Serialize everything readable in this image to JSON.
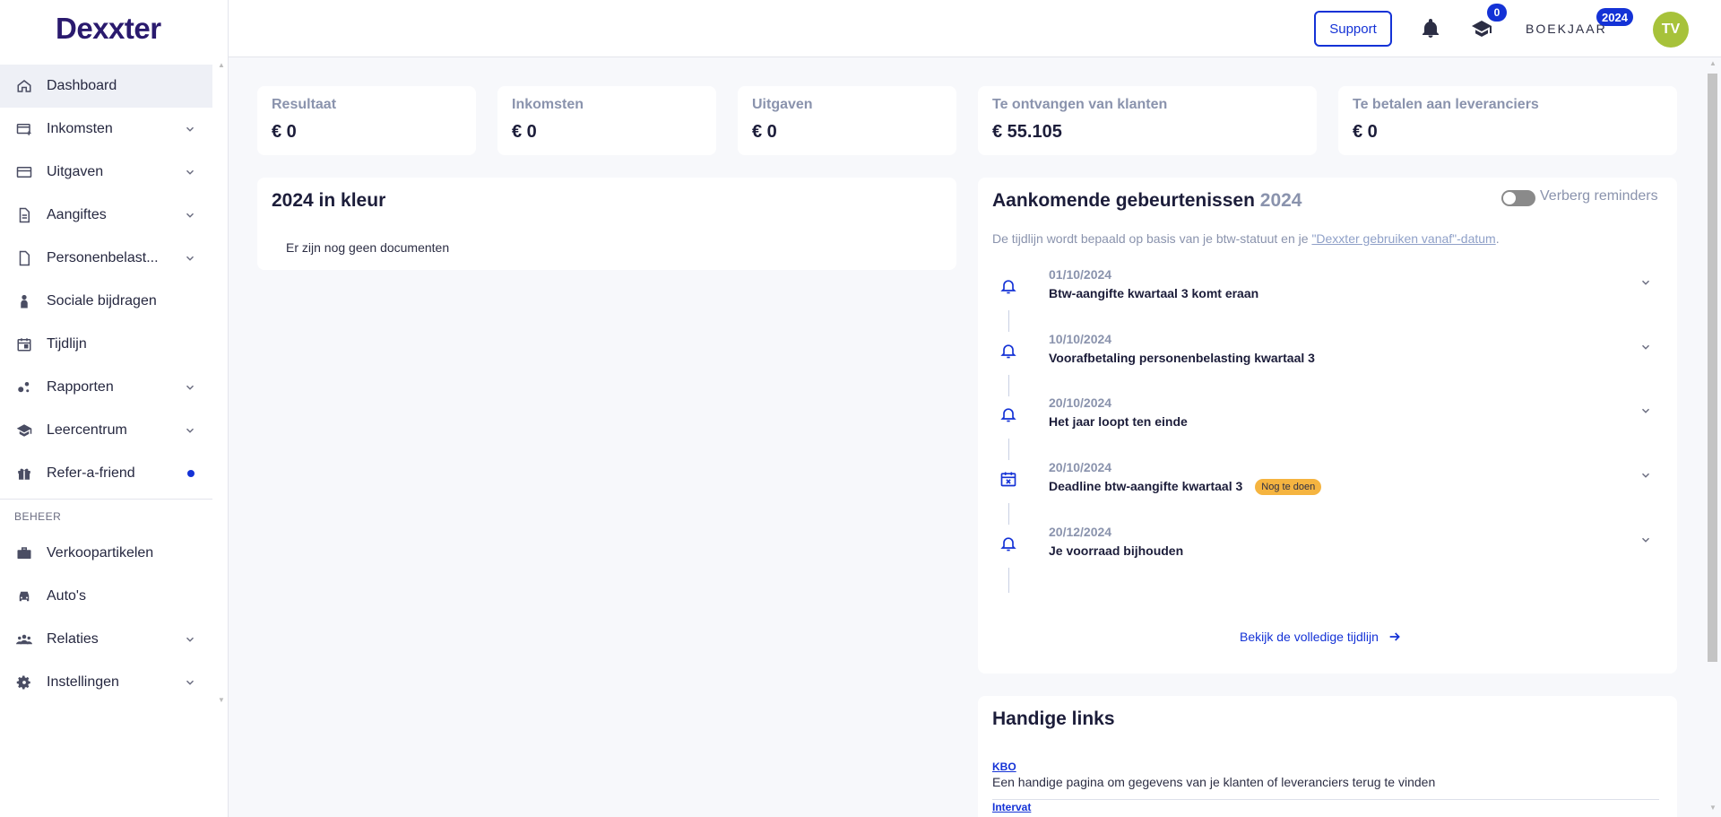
{
  "app": {
    "logo": "Dexxter"
  },
  "sidebar": {
    "items": [
      {
        "label": "Dashboard",
        "icon": "home-icon",
        "active": true
      },
      {
        "label": "Inkomsten",
        "icon": "invoice-icon",
        "expandable": true
      },
      {
        "label": "Uitgaven",
        "icon": "card-icon",
        "expandable": true
      },
      {
        "label": "Aangiftes",
        "icon": "document-icon",
        "expandable": true
      },
      {
        "label": "Personenbelast...",
        "icon": "file-icon",
        "expandable": true
      },
      {
        "label": "Sociale bijdragen",
        "icon": "person-icon"
      },
      {
        "label": "Tijdlijn",
        "icon": "calendar-icon"
      },
      {
        "label": "Rapporten",
        "icon": "chart-bubbles-icon",
        "expandable": true
      },
      {
        "label": "Leercentrum",
        "icon": "graduation-cap-icon",
        "expandable": true
      },
      {
        "label": "Refer-a-friend",
        "icon": "gift-icon",
        "dot": true
      }
    ],
    "section_title": "BEHEER",
    "beheer_items": [
      {
        "label": "Verkoopartikelen",
        "icon": "briefcase-icon"
      },
      {
        "label": "Auto's",
        "icon": "car-icon"
      },
      {
        "label": "Relaties",
        "icon": "people-icon",
        "expandable": true
      },
      {
        "label": "Instellingen",
        "icon": "gear-icon",
        "expandable": true
      }
    ]
  },
  "header": {
    "support_label": "Support",
    "notifications_count": "0",
    "boekjaar_label": "BOEKJAAR",
    "boekjaar_year": "2024",
    "avatar_initials": "TV",
    "colors": {
      "accent": "#1432d6",
      "avatar": "#a7c23a"
    }
  },
  "stats": [
    {
      "label": "Resultaat",
      "value": "€ 0"
    },
    {
      "label": "Inkomsten",
      "value": "€ 0"
    },
    {
      "label": "Uitgaven",
      "value": "€ 0"
    },
    {
      "label": "Te ontvangen van klanten",
      "value": "€ 55.105"
    },
    {
      "label": "Te betalen aan leveranciers",
      "value": "€ 0"
    }
  ],
  "kleur": {
    "title": "2024 in kleur",
    "empty": "Er zijn nog geen documenten"
  },
  "events": {
    "title": "Aankomende gebeurtenissen",
    "year": "2024",
    "toggle_label": "Verberg reminders",
    "description_prefix": "De tijdlijn wordt bepaald op basis van je btw-statuut en je ",
    "description_link": "\"Dexxter gebruiken vanaf\"-datum",
    "description_suffix": ".",
    "items": [
      {
        "date": "01/10/2024",
        "title": "Btw-aangifte kwartaal 3 komt eraan",
        "icon": "bell-icon"
      },
      {
        "date": "10/10/2024",
        "title": "Voorafbetaling personenbelasting kwartaal 3",
        "icon": "bell-icon"
      },
      {
        "date": "20/10/2024",
        "title": "Het jaar loopt ten einde",
        "icon": "bell-icon"
      },
      {
        "date": "20/10/2024",
        "title": "Deadline btw-aangifte kwartaal 3",
        "icon": "calendar-x-icon",
        "badge": "Nog te doen"
      },
      {
        "date": "20/12/2024",
        "title": "Je voorraad bijhouden",
        "icon": "bell-icon"
      }
    ],
    "full_link": "Bekijk de volledige tijdlijn"
  },
  "links": {
    "title": "Handige links",
    "items": [
      {
        "label": "KBO",
        "description": "Een handige pagina om gegevens van je klanten of leveranciers terug te vinden"
      },
      {
        "label": "Intervat",
        "description": ""
      }
    ]
  }
}
